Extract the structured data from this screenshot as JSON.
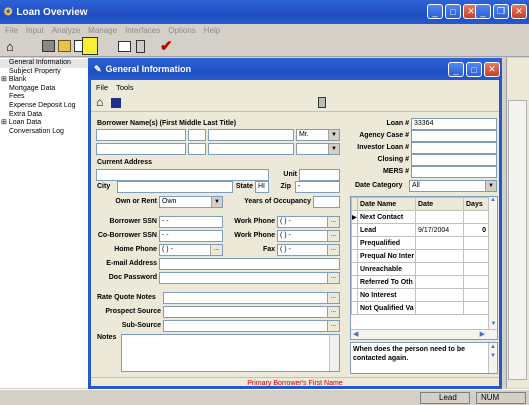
{
  "app": {
    "title": "Loan Overview"
  },
  "main_menu": [
    "File",
    "Input",
    "Analyze",
    "Manage",
    "Interfaces",
    "Options",
    "Help"
  ],
  "tree": [
    "General Information",
    "Subject Property",
    "Blank",
    "Mortgage Data",
    "Fees",
    "Expense Deposit Log",
    "Extra Data",
    "Loan Data",
    "Conversation Log"
  ],
  "dialog": {
    "title": "General Information",
    "menu": [
      "File",
      "Tools"
    ],
    "borrower_header": "Borrower Name(s) (First Middle Last Title)",
    "title_value": "Mr.",
    "current_address": "Current Address",
    "unit_label": "Unit",
    "city_label": "City",
    "state_label": "State",
    "state_value": "HI",
    "zip_label": "Zip",
    "zip_value": "-",
    "own_rent_label": "Own or Rent",
    "own_rent_value": "Own",
    "years_label": "Years of Occupancy",
    "borrower_ssn_label": "Borrower SSN",
    "borrower_ssn": "- -",
    "co_ssn_label": "Co-Borrower SSN",
    "co_ssn": "- -",
    "home_phone_label": "Home Phone",
    "home_phone": "( ) -",
    "work_phone_label": "Work Phone",
    "work_phone": "( ) -",
    "work_phone2": "( ) -",
    "fax_label": "Fax",
    "fax": "( ) -",
    "email_label": "E-mail Address",
    "doc_pw_label": "Doc Password",
    "rate_notes_label": "Rate Quote Notes",
    "prospect_label": "Prospect Source",
    "subsource_label": "Sub-Source",
    "notes_label": "Notes",
    "loan_no_label": "Loan #",
    "loan_no": "33364",
    "agency_label": "Agency Case #",
    "investor_label": "Investor Loan #",
    "closing_label": "Closing #",
    "mers_label": "MERS #",
    "date_cat_label": "Date Category",
    "date_cat": "All",
    "grid_cols": [
      "Date Name",
      "Date",
      "Days"
    ],
    "grid_rows": [
      [
        "Next Contact",
        "",
        ""
      ],
      [
        "Lead",
        "9/17/2004",
        "0"
      ],
      [
        "Prequalified",
        "",
        ""
      ],
      [
        "Prequal No Inter",
        "",
        ""
      ],
      [
        "Unreachable",
        "",
        ""
      ],
      [
        "Referred To Oth",
        "",
        ""
      ],
      [
        "No Interest",
        "",
        ""
      ],
      [
        "Not Qualified Va",
        "",
        ""
      ]
    ],
    "help_text": "When does the person need to be contacted again.",
    "status_hint": "Primary Borrower's First Name"
  },
  "statusbar": {
    "lead": "Lead",
    "num": "NUM"
  },
  "colors": {
    "titlebar": "#2458cf",
    "tree_bg": "#ffffff",
    "hint": "#c00000"
  }
}
